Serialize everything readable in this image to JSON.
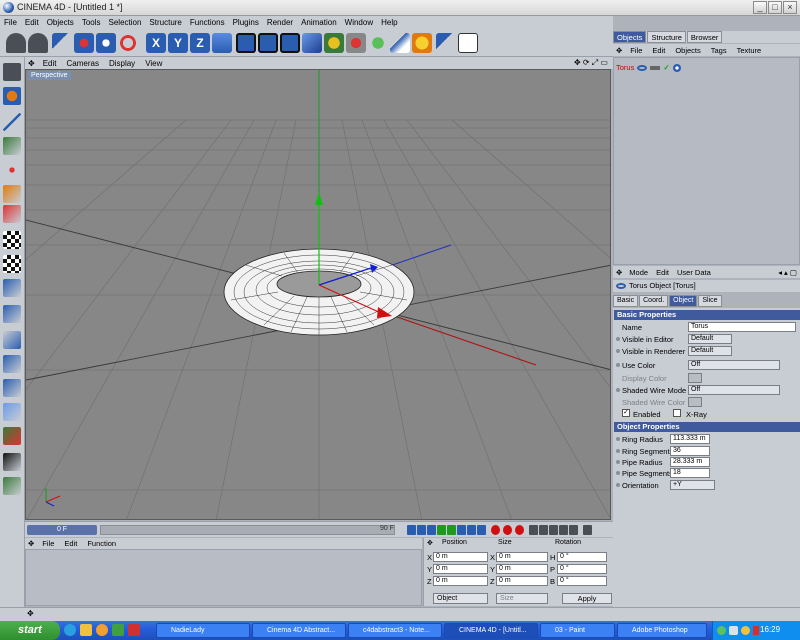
{
  "window": {
    "title": "CINEMA 4D - [Untitled 1 *]"
  },
  "menubar": [
    "File",
    "Edit",
    "Objects",
    "Tools",
    "Selection",
    "Structure",
    "Functions",
    "Plugins",
    "Render",
    "Animation",
    "Window",
    "Help"
  ],
  "viewport": {
    "menu": [
      "Edit",
      "Cameras",
      "Display",
      "View"
    ],
    "label": "Perspective"
  },
  "timeline": {
    "start_frame": "0 F",
    "end_frame": "90 F"
  },
  "material_menu": [
    "File",
    "Edit",
    "Function"
  ],
  "coordinates": {
    "headers": {
      "position": "Position",
      "size": "Size",
      "rotation": "Rotation"
    },
    "rows": [
      {
        "axis": "X",
        "pos": "0 m",
        "saxis": "X",
        "size": "0 m",
        "raxis": "H",
        "rot": "0 °"
      },
      {
        "axis": "Y",
        "pos": "0 m",
        "saxis": "Y",
        "size": "0 m",
        "raxis": "P",
        "rot": "0 °"
      },
      {
        "axis": "Z",
        "pos": "0 m",
        "saxis": "Z",
        "size": "0 m",
        "raxis": "B",
        "rot": "0 °"
      }
    ],
    "mode": "Object",
    "size_mode": "Size",
    "apply": "Apply"
  },
  "object_manager": {
    "tabs": [
      "Objects",
      "Structure",
      "Browser"
    ],
    "menu": [
      "File",
      "Edit",
      "Objects",
      "Tags",
      "Texture"
    ],
    "object_name": "Torus"
  },
  "attribute_manager": {
    "menu": [
      "Mode",
      "Edit",
      "User Data"
    ],
    "header": "Torus Object [Torus]",
    "tabs": [
      "Basic",
      "Coord.",
      "Object",
      "Slice"
    ],
    "basic_title": "Basic Properties",
    "basic": [
      {
        "label": "Name",
        "value": "Torus"
      },
      {
        "label": "Visible in Editor",
        "value": "Default"
      },
      {
        "label": "Visible in Renderer",
        "value": "Default"
      },
      {
        "label": "Use Color",
        "value": "Off"
      },
      {
        "label": "Display Color",
        "value": ""
      },
      {
        "label": "Shaded Wire Mode",
        "value": "Off"
      },
      {
        "label": "Shaded Wire Color",
        "value": ""
      }
    ],
    "enabled_label": "Enabled",
    "xray_label": "X-Ray",
    "object_title": "Object Properties",
    "object": [
      {
        "label": "Ring Radius",
        "value": "113.333 m"
      },
      {
        "label": "Ring Segments",
        "value": "36"
      },
      {
        "label": "Pipe Radius",
        "value": "28.333 m"
      },
      {
        "label": "Pipe Segments",
        "value": "18"
      },
      {
        "label": "Orientation",
        "value": "+Y"
      }
    ]
  },
  "taskbar": {
    "start": "start",
    "tasks": [
      "NadieLady",
      "Cinema 4D Abstract...",
      "c4dabstract3 - Note...",
      "CINEMA 4D - [Untitl...",
      "03 - Paint",
      "Adobe Photoshop"
    ],
    "clock": "16:29"
  }
}
